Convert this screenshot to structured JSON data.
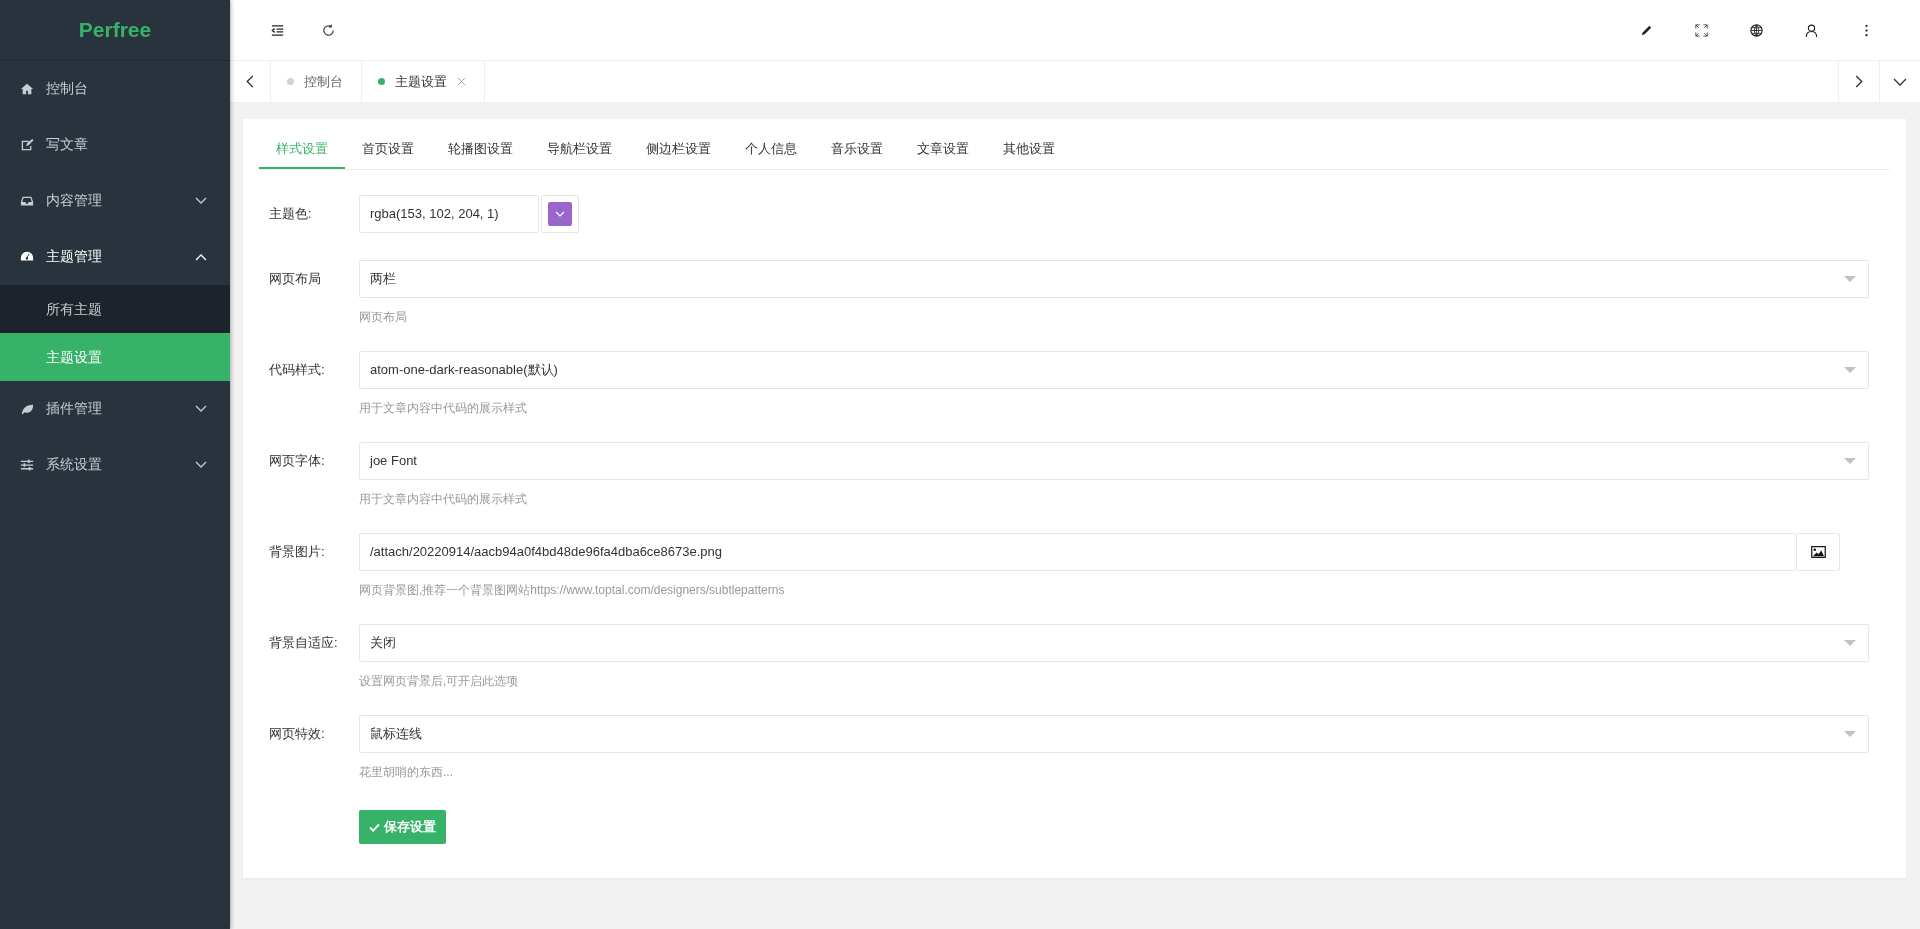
{
  "sidebar": {
    "logo": "Perfree",
    "items": [
      {
        "label": "控制台",
        "selected": false
      },
      {
        "label": "写文章",
        "selected": false
      },
      {
        "label": "内容管理",
        "selected": false,
        "expanded": false
      },
      {
        "label": "主题管理",
        "selected": false,
        "expanded": true,
        "children": [
          {
            "label": "所有主题",
            "selected": false
          },
          {
            "label": "主题设置",
            "selected": true
          }
        ]
      },
      {
        "label": "插件管理",
        "selected": false,
        "expanded": false
      },
      {
        "label": "系统设置",
        "selected": false,
        "expanded": false
      }
    ]
  },
  "page_tabs": [
    {
      "label": "控制台",
      "selected": false,
      "closable": false
    },
    {
      "label": "主题设置",
      "selected": true,
      "closable": true
    }
  ],
  "settings_tabs": [
    {
      "label": "样式设置",
      "selected": true
    },
    {
      "label": "首页设置",
      "selected": false
    },
    {
      "label": "轮播图设置",
      "selected": false
    },
    {
      "label": "导航栏设置",
      "selected": false
    },
    {
      "label": "侧边栏设置",
      "selected": false
    },
    {
      "label": "个人信息",
      "selected": false
    },
    {
      "label": "音乐设置",
      "selected": false
    },
    {
      "label": "文章设置",
      "selected": false
    },
    {
      "label": "其他设置",
      "selected": false
    }
  ],
  "form": {
    "fields": [
      {
        "kind": "color",
        "label": "主题色:",
        "value": "rgba(153, 102, 204, 1)",
        "color": "#9966cc"
      },
      {
        "kind": "select",
        "label": "网页布局",
        "value": "两栏",
        "help": "网页布局"
      },
      {
        "kind": "select",
        "label": "代码样式:",
        "value": "atom-one-dark-reasonable(默认)",
        "help": "用于文章内容中代码的展示样式"
      },
      {
        "kind": "select",
        "label": "网页字体:",
        "value": "joe Font",
        "help": "用于文章内容中代码的展示样式"
      },
      {
        "kind": "image",
        "label": "背景图片:",
        "value": "/attach/20220914/aacb94a0f4bd48de96fa4dba6ce8673e.png",
        "help": "网页背景图,推荐一个背景图网站https://www.toptal.com/designers/subtlepatterns"
      },
      {
        "kind": "select",
        "label": "背景自适应:",
        "value": "关闭",
        "help": "设置网页背景后,可开启此选项"
      },
      {
        "kind": "select",
        "label": "网页特效:",
        "value": "鼠标连线",
        "help": "花里胡哨的东西..."
      }
    ],
    "save_button": "保存设置"
  }
}
